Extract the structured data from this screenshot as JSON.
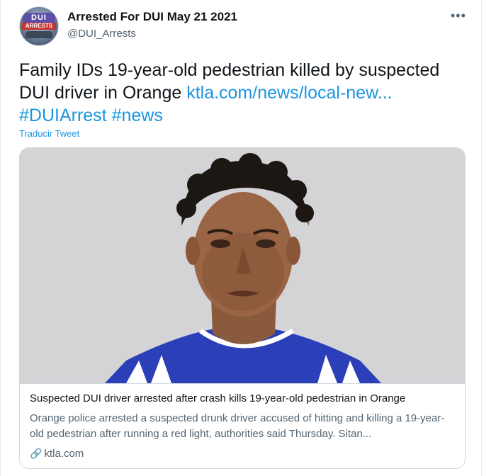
{
  "account": {
    "display_name": "Arrested For DUI May 21 2021",
    "handle": "@DUI_Arrests",
    "avatar_logo_top": "DUI",
    "avatar_logo_sub": "ARRESTS"
  },
  "tweet": {
    "text_plain": "Family IDs 19-year-old pedestrian killed by suspected DUI driver in Orange ",
    "link_text": "ktla.com/news/local-new...",
    "hashtag_1": "#DUIArrest",
    "hashtag_2": "#news",
    "translate_label": "Traducir Tweet"
  },
  "card": {
    "title": "Suspected DUI driver arrested after crash kills 19-year-old pedestrian in Orange",
    "description": "Orange police arrested a suspected drunk driver accused of hitting and killing a 19-year-old pedestrian after running a red light, authorities said Thursday. Sitan...",
    "domain": "ktla.com",
    "image_icon": "mugshot-photo"
  },
  "icons": {
    "more": "more-options-icon",
    "link": "link-icon"
  },
  "colors": {
    "link_blue": "#1b95e0",
    "secondary_text": "#536471",
    "border": "#cfd9de"
  }
}
